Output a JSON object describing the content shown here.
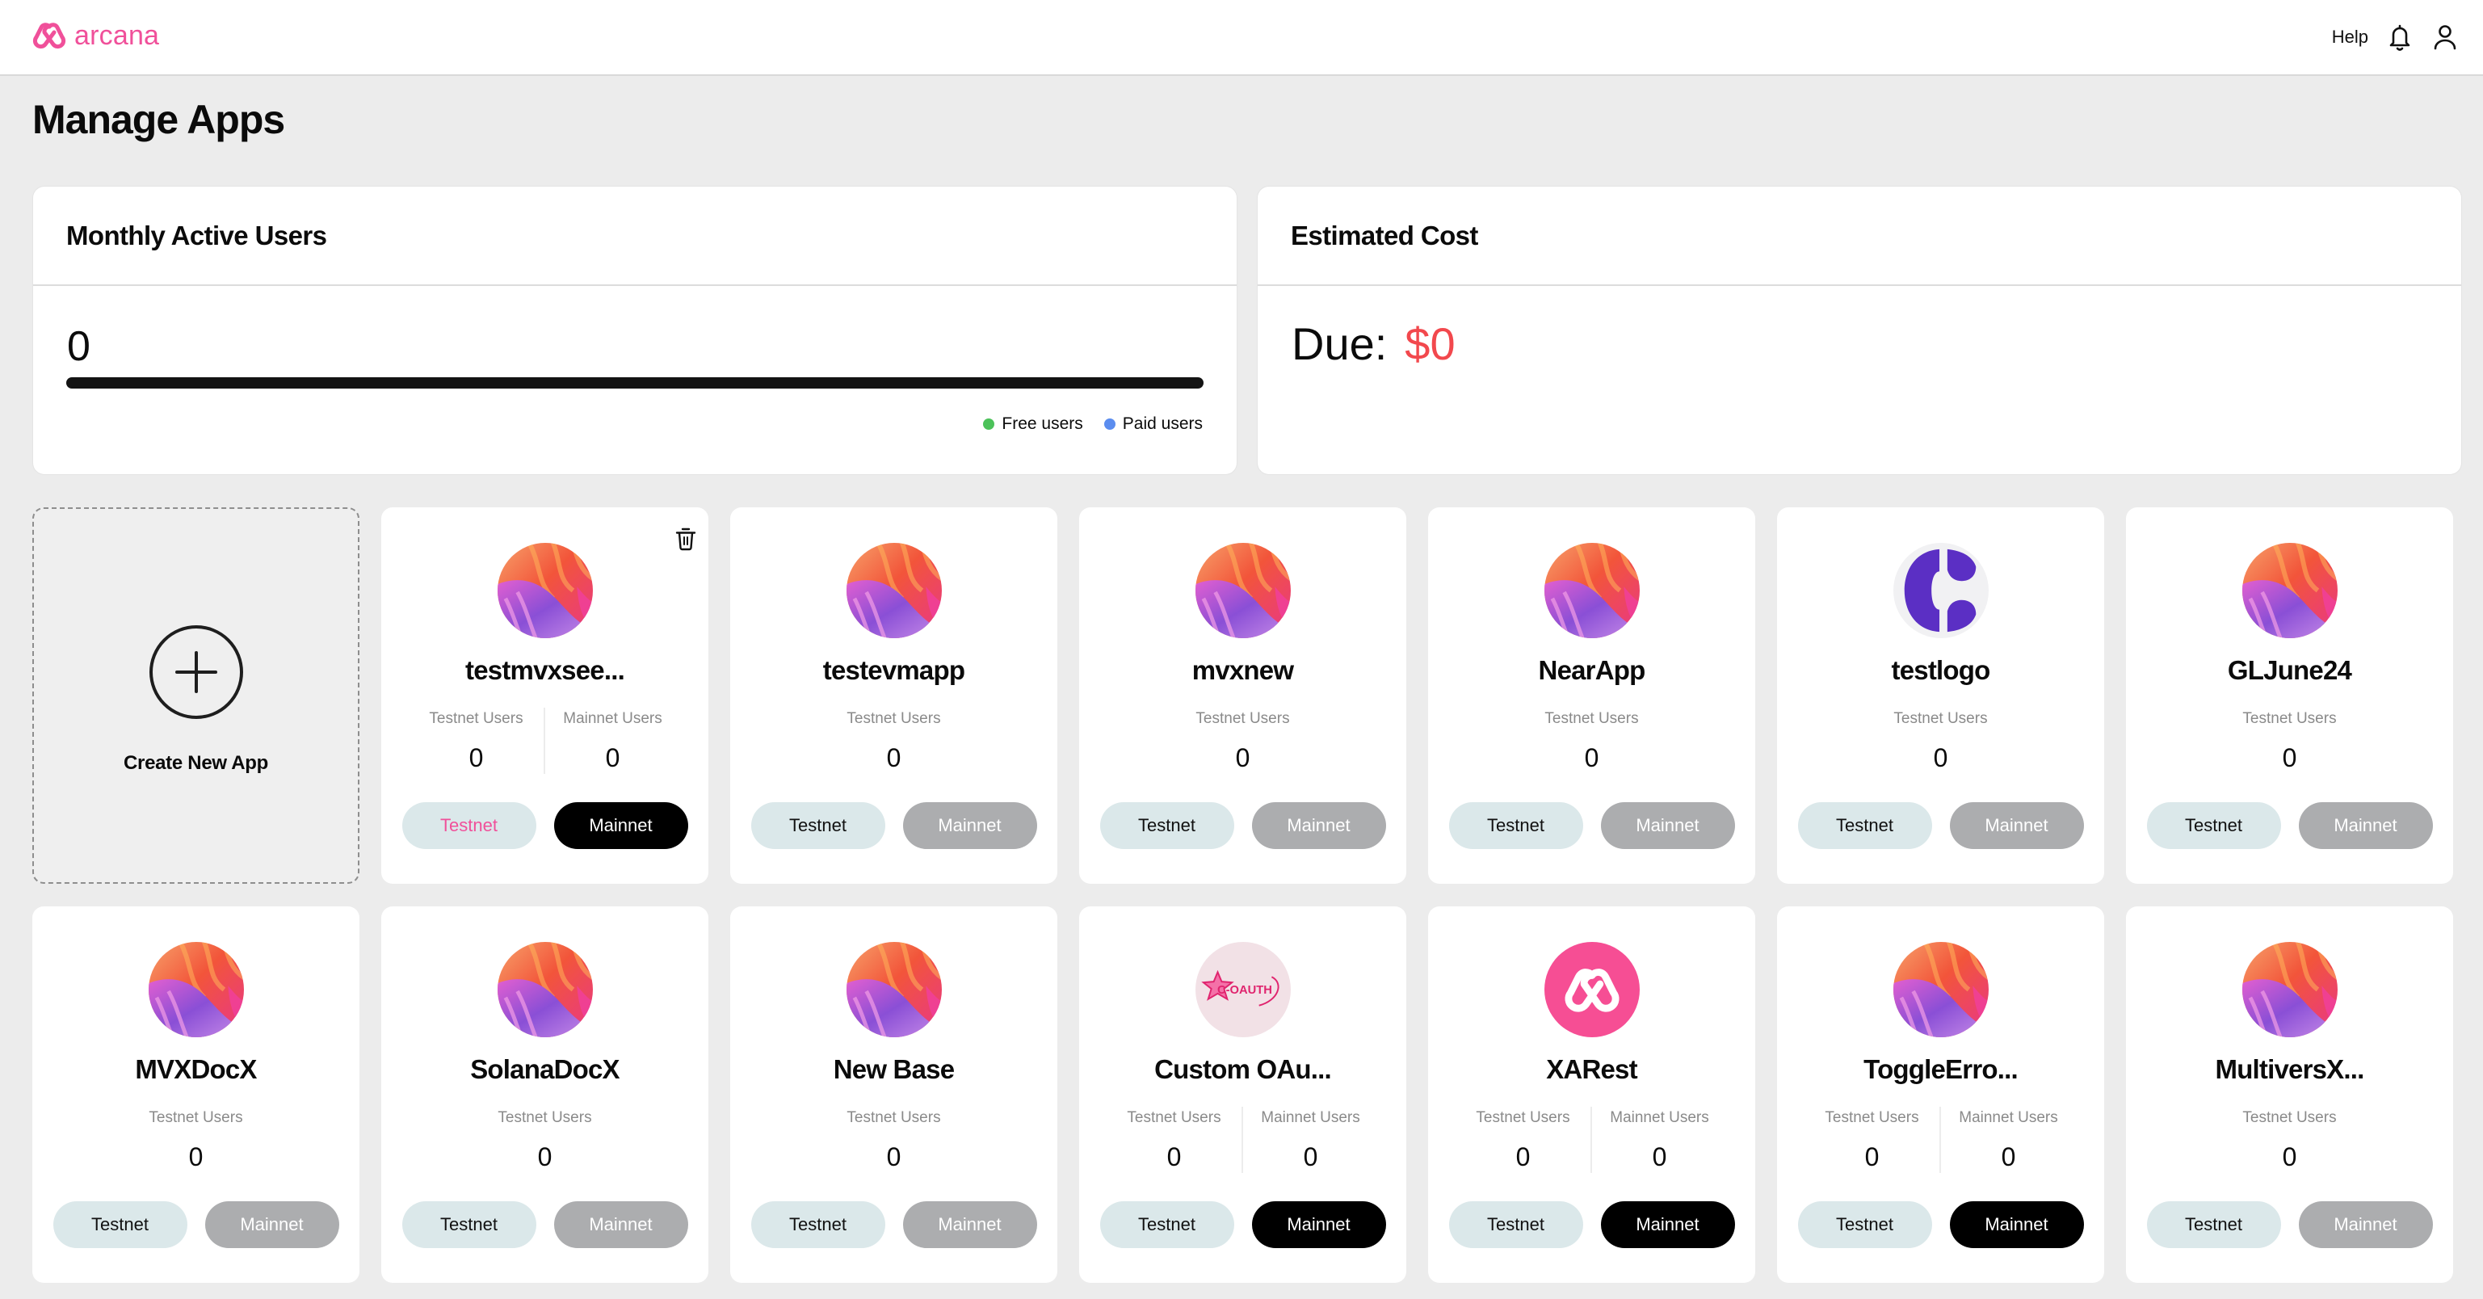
{
  "header": {
    "brand": "arcana",
    "help_label": "Help",
    "icons": [
      "arcana-logo-icon",
      "bell-icon",
      "user-icon"
    ]
  },
  "page": {
    "title": "Manage Apps"
  },
  "mau_card": {
    "title": "Monthly Active Users",
    "value": "0",
    "progress_fraction": 0,
    "legend": [
      {
        "label": "Free users",
        "color": "#4cc25a"
      },
      {
        "label": "Paid users",
        "color": "#5b8def"
      }
    ]
  },
  "cost_card": {
    "title": "Estimated Cost",
    "due_label": "Due:",
    "due_amount": "$0",
    "due_color": "#f2484d"
  },
  "create_app": {
    "label": "Create New App",
    "icon": "plus-circle-icon"
  },
  "colors": {
    "brand": "#f0509a",
    "testnet_bg": "#dbe8ea",
    "mainnet_enabled": "#000000",
    "mainnet_disabled": "#acadaf"
  },
  "apps": [
    {
      "name": "testmvxsee...",
      "logo": "gradient",
      "show_delete": true,
      "testnet_active": true,
      "mainnet_enabled": true,
      "stats": [
        {
          "label": "Testnet Users",
          "value": "0"
        },
        {
          "label": "Mainnet Users",
          "value": "0"
        }
      ],
      "testnet_label": "Testnet",
      "mainnet_label": "Mainnet"
    },
    {
      "name": "testevmapp",
      "logo": "gradient",
      "show_delete": false,
      "testnet_active": false,
      "mainnet_enabled": false,
      "stats": [
        {
          "label": "Testnet Users",
          "value": "0"
        }
      ],
      "testnet_label": "Testnet",
      "mainnet_label": "Mainnet"
    },
    {
      "name": "mvxnew",
      "logo": "gradient",
      "show_delete": false,
      "testnet_active": false,
      "mainnet_enabled": false,
      "stats": [
        {
          "label": "Testnet Users",
          "value": "0"
        }
      ],
      "testnet_label": "Testnet",
      "mainnet_label": "Mainnet"
    },
    {
      "name": "NearApp",
      "logo": "gradient",
      "show_delete": false,
      "testnet_active": false,
      "mainnet_enabled": false,
      "stats": [
        {
          "label": "Testnet Users",
          "value": "0"
        }
      ],
      "testnet_label": "Testnet",
      "mainnet_label": "Mainnet"
    },
    {
      "name": "testlogo",
      "logo": "c-letter",
      "show_delete": false,
      "testnet_active": false,
      "mainnet_enabled": false,
      "stats": [
        {
          "label": "Testnet Users",
          "value": "0"
        }
      ],
      "testnet_label": "Testnet",
      "mainnet_label": "Mainnet"
    },
    {
      "name": "GLJune24",
      "logo": "gradient",
      "show_delete": false,
      "testnet_active": false,
      "mainnet_enabled": false,
      "stats": [
        {
          "label": "Testnet Users",
          "value": "0"
        }
      ],
      "testnet_label": "Testnet",
      "mainnet_label": "Mainnet"
    },
    {
      "name": "MVXDocX",
      "logo": "gradient",
      "show_delete": false,
      "testnet_active": false,
      "mainnet_enabled": false,
      "stats": [
        {
          "label": "Testnet Users",
          "value": "0"
        }
      ],
      "testnet_label": "Testnet",
      "mainnet_label": "Mainnet"
    },
    {
      "name": "SolanaDocX",
      "logo": "gradient",
      "show_delete": false,
      "testnet_active": false,
      "mainnet_enabled": false,
      "stats": [
        {
          "label": "Testnet Users",
          "value": "0"
        }
      ],
      "testnet_label": "Testnet",
      "mainnet_label": "Mainnet"
    },
    {
      "name": "New Base",
      "logo": "gradient",
      "show_delete": false,
      "testnet_active": false,
      "mainnet_enabled": false,
      "stats": [
        {
          "label": "Testnet Users",
          "value": "0"
        }
      ],
      "testnet_label": "Testnet",
      "mainnet_label": "Mainnet"
    },
    {
      "name": "Custom OAu...",
      "logo": "c-oauth",
      "logo_text": "C-OAUTH",
      "show_delete": false,
      "testnet_active": false,
      "mainnet_enabled": true,
      "stats": [
        {
          "label": "Testnet Users",
          "value": "0"
        },
        {
          "label": "Mainnet Users",
          "value": "0"
        }
      ],
      "testnet_label": "Testnet",
      "mainnet_label": "Mainnet"
    },
    {
      "name": "XARest",
      "logo": "arcana",
      "show_delete": false,
      "testnet_active": false,
      "mainnet_enabled": true,
      "stats": [
        {
          "label": "Testnet Users",
          "value": "0"
        },
        {
          "label": "Mainnet Users",
          "value": "0"
        }
      ],
      "testnet_label": "Testnet",
      "mainnet_label": "Mainnet"
    },
    {
      "name": "ToggleErro...",
      "logo": "gradient",
      "show_delete": false,
      "testnet_active": false,
      "mainnet_enabled": true,
      "stats": [
        {
          "label": "Testnet Users",
          "value": "0"
        },
        {
          "label": "Mainnet Users",
          "value": "0"
        }
      ],
      "testnet_label": "Testnet",
      "mainnet_label": "Mainnet"
    },
    {
      "name": "MultiversX...",
      "logo": "gradient",
      "show_delete": false,
      "testnet_active": false,
      "mainnet_enabled": false,
      "stats": [
        {
          "label": "Testnet Users",
          "value": "0"
        }
      ],
      "testnet_label": "Testnet",
      "mainnet_label": "Mainnet"
    }
  ]
}
